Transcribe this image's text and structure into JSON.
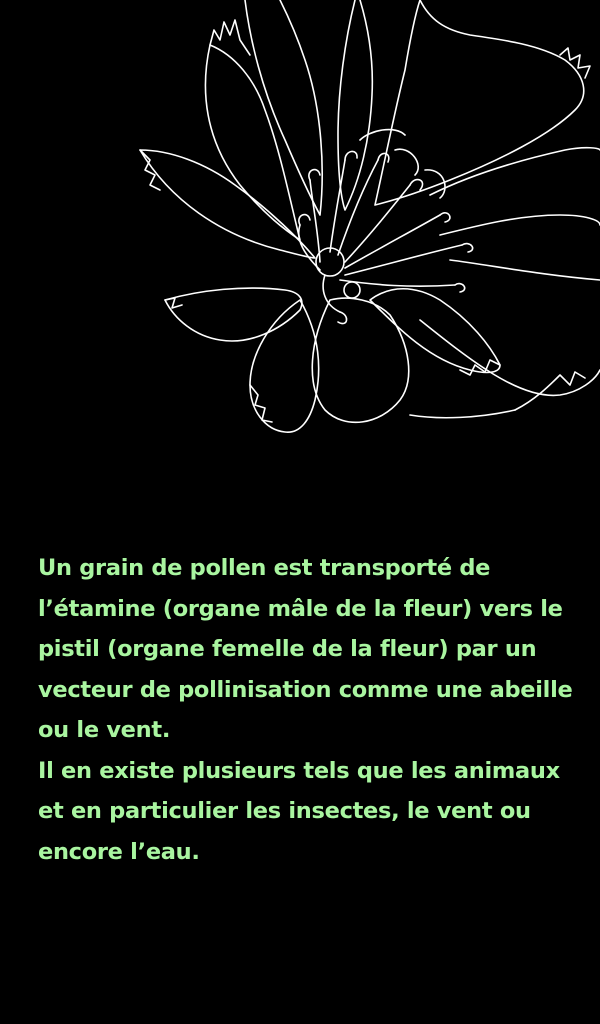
{
  "illustration": {
    "subject": "flower-line-drawing",
    "stroke_color": "#ffffff",
    "background_color": "#000000"
  },
  "text": {
    "color": "#a9f5a0",
    "paragraph_1": "Un grain de pollen est transporté de l’étamine (organe mâle de la fleur) vers le pistil (organe femelle de la fleur) par un vecteur de pollinisation comme une abeille ou le vent.",
    "paragraph_2": "Il en existe plusieurs tels que les animaux et en particulier les insectes, le vent ou encore l’eau."
  }
}
